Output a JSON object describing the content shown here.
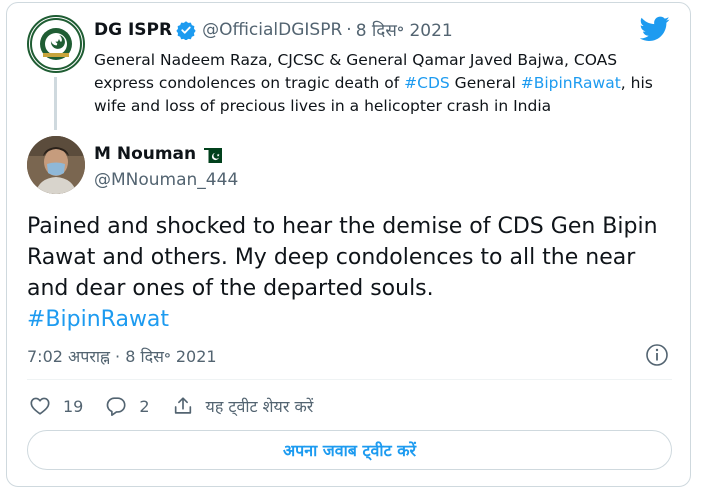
{
  "parent_tweet": {
    "name": "DG ISPR",
    "handle": "@OfficialDGISPR",
    "separator": "·",
    "date": "8 दिस॰ 2021",
    "text_before_1": "General Nadeem Raza, CJCSC & General Qamar Javed Bajwa, COAS express condolences on tragic death of ",
    "hashtag_1": "#CDS",
    "text_between": " General ",
    "hashtag_2": "#BipinRawat",
    "text_after": ", his wife and loss of precious lives in a helicopter crash in India"
  },
  "tweet": {
    "name": "M Nouman",
    "flag_icon": "pakistan-flag-icon",
    "handle": "@MNouman_444",
    "text": "Pained and shocked to hear the demise of CDS Gen Bipin Rawat and others. My deep condolences to all the near and dear ones of the departed souls.",
    "hashtag": "#BipinRawat",
    "timestamp": "7:02 अपराह्न · 8 दिस॰ 2021"
  },
  "actions": {
    "likes": "19",
    "replies": "2",
    "share_label": "यह ट्वीट शेयर करें"
  },
  "reply_button": "अपना जवाब ट्वीट करें",
  "colors": {
    "accent": "#1d9bf0",
    "text": "#0f1419",
    "muted": "#536471",
    "border": "#cfd9de"
  }
}
